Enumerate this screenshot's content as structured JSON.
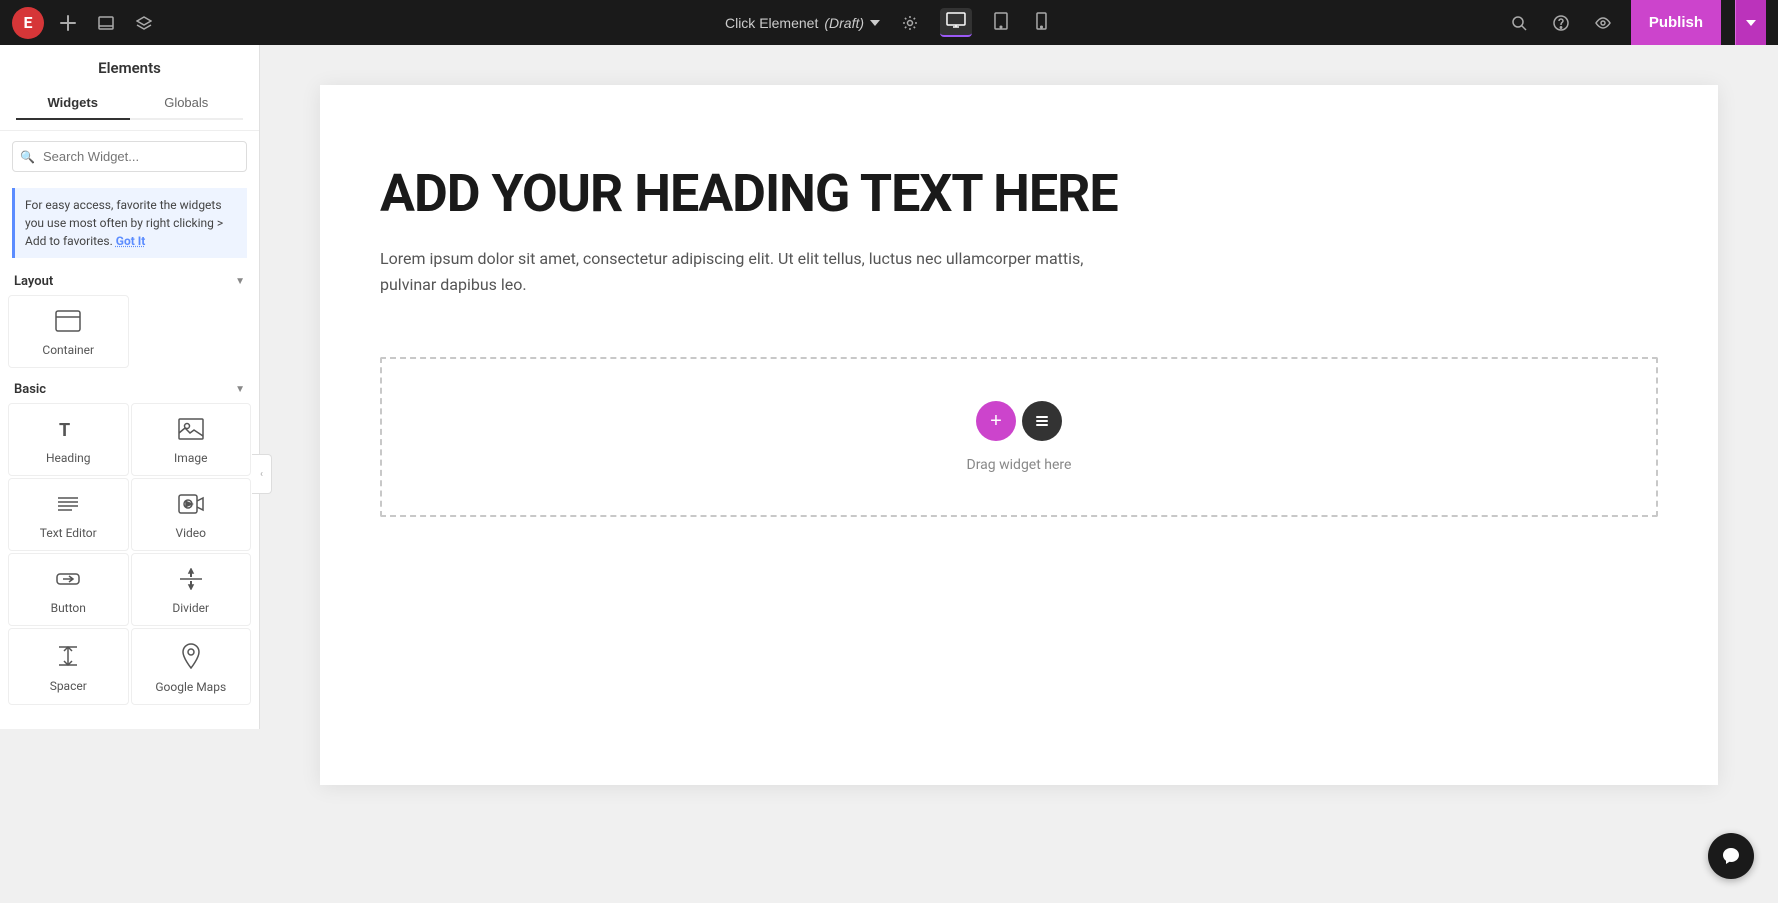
{
  "topbar": {
    "logo": "E",
    "page_title": "Click Elemenet",
    "page_status": "(Draft)",
    "publish_label": "Publish",
    "tabs": {
      "widgets_label": "Widgets",
      "globals_label": "Globals"
    }
  },
  "sidebar": {
    "title": "Elements",
    "search_placeholder": "Search Widget...",
    "tip": {
      "text": "For easy access, favorite the widgets you use most often by right clicking > Add to favorites.",
      "link_text": "Got It"
    },
    "layout_section": {
      "title": "Layout",
      "widgets": [
        {
          "label": "Container",
          "icon": "container"
        }
      ]
    },
    "basic_section": {
      "title": "Basic",
      "widgets": [
        {
          "label": "Heading",
          "icon": "heading"
        },
        {
          "label": "Image",
          "icon": "image"
        },
        {
          "label": "Text Editor",
          "icon": "text-editor"
        },
        {
          "label": "Video",
          "icon": "video"
        },
        {
          "label": "Button",
          "icon": "button"
        },
        {
          "label": "Divider",
          "icon": "divider"
        },
        {
          "label": "Spacer",
          "icon": "spacer"
        },
        {
          "label": "Google Maps",
          "icon": "google-maps"
        }
      ]
    }
  },
  "canvas": {
    "heading": "ADD YOUR HEADING TEXT HERE",
    "body_text": "Lorem ipsum dolor sit amet, consectetur adipiscing elit. Ut elit tellus, luctus nec ullamcorper mattis, pulvinar dapibus leo.",
    "drop_zone_label": "Drag widget here"
  }
}
